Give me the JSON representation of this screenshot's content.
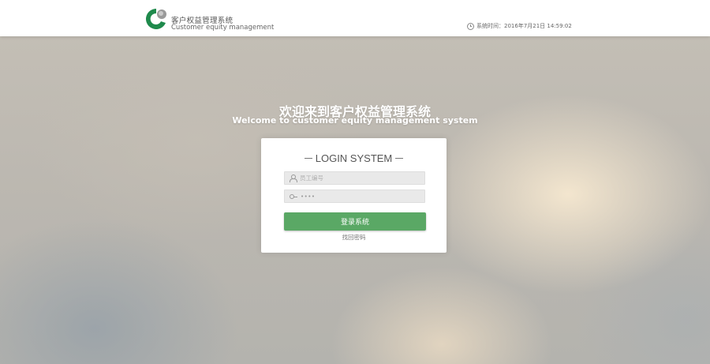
{
  "header": {
    "brand_cn": "客户权益管理系统",
    "brand_en": "Customer equity management",
    "system_time": "系统时间：2016年7月21日 14:59:02"
  },
  "welcome": {
    "title_cn": "欢迎来到客户权益管理系统",
    "title_en": "Welcome to customer equity management system"
  },
  "login": {
    "title": "LOGIN SYSTEM",
    "username_placeholder": "员工编号",
    "password_value": "••••",
    "submit_label": "登录系统",
    "forgot_label": "找回密码"
  },
  "colors": {
    "brand_green": "#1f8a4c",
    "button_green": "#5aa865"
  },
  "icons": {
    "logo": "company-logo",
    "clock": "clock-icon",
    "user": "user-icon",
    "password": "key-icon"
  }
}
